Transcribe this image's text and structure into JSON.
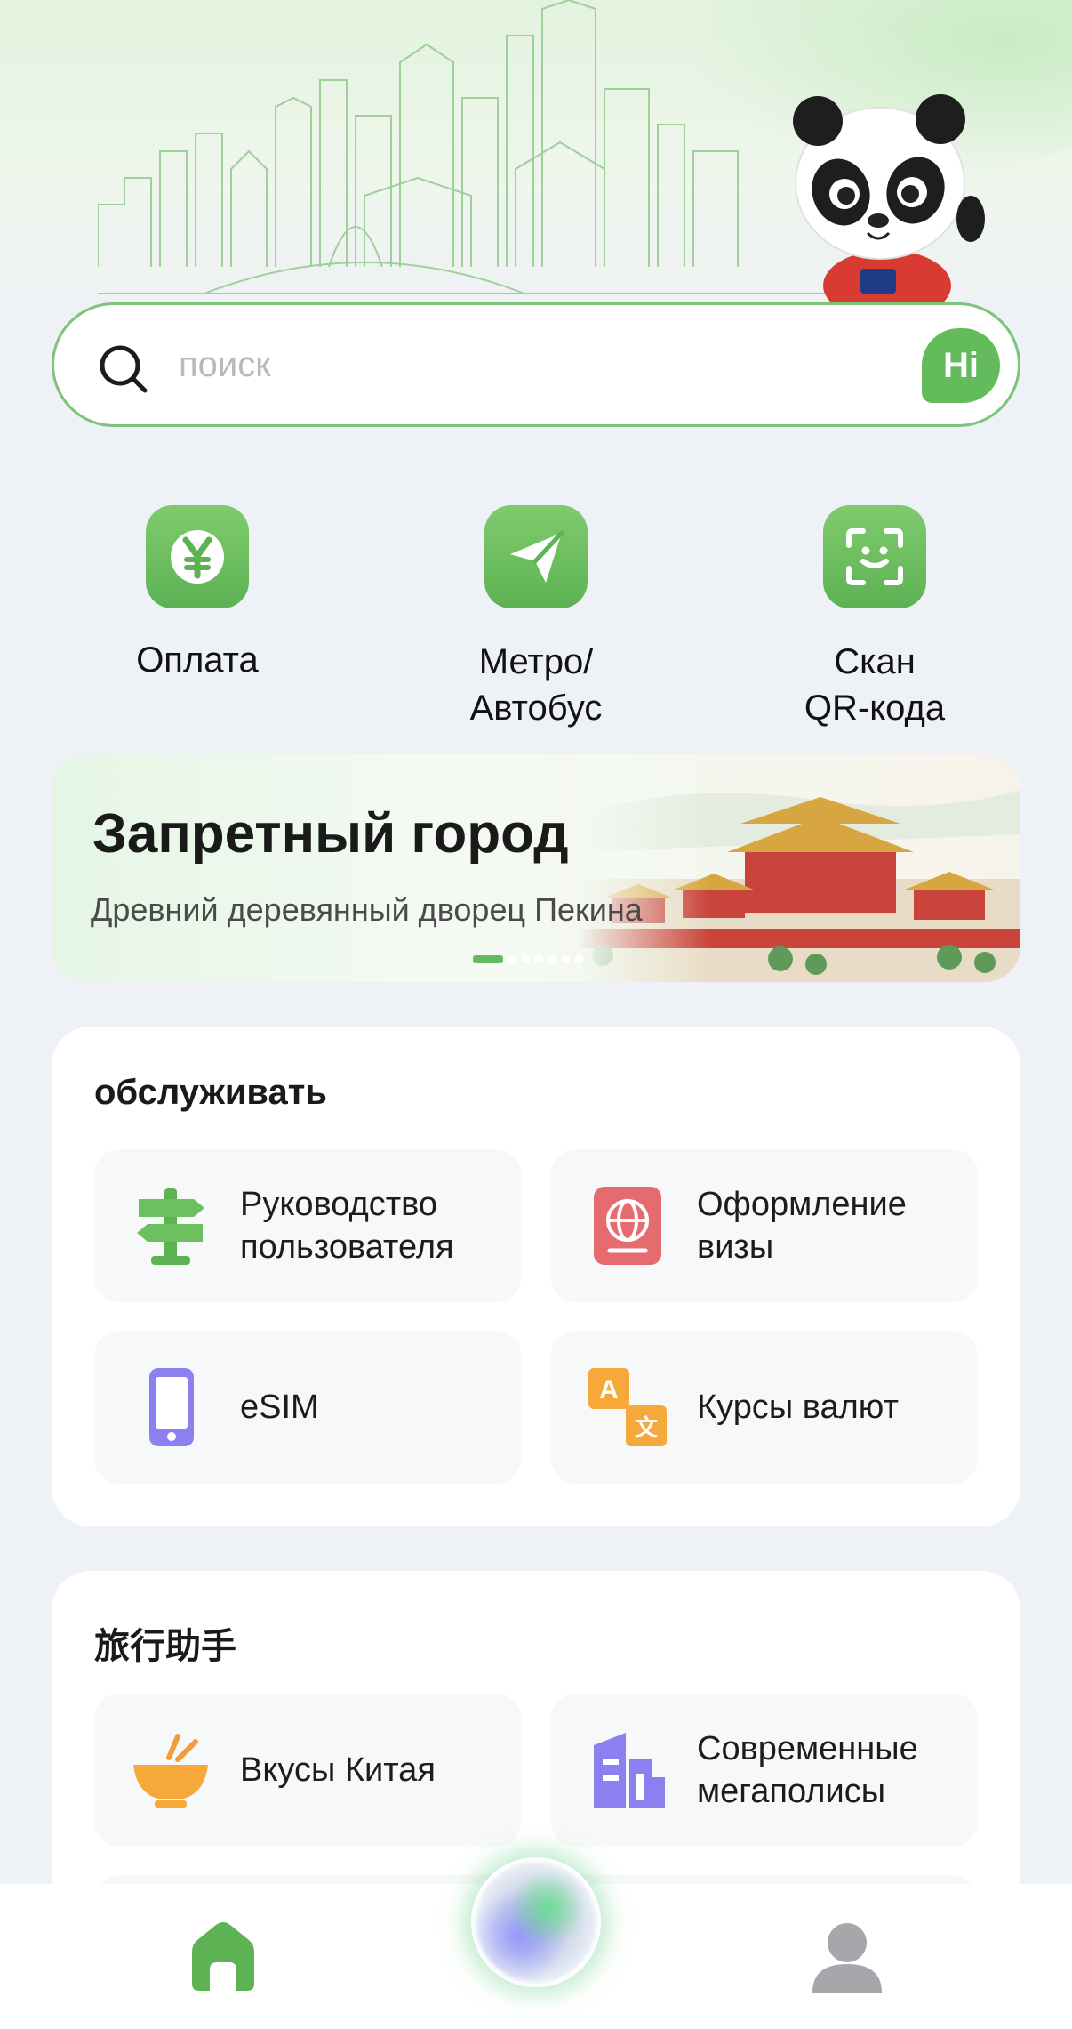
{
  "search": {
    "placeholder": "поиск",
    "hi_label": "Hi"
  },
  "quick_actions": [
    {
      "label": "Оплата",
      "icon": "yuan-icon"
    },
    {
      "label": "Метро/\nАвтобус",
      "icon": "paper-plane-icon"
    },
    {
      "label": "Скан\nQR-кода",
      "icon": "scan-icon"
    }
  ],
  "banner": {
    "title": "Запретный город",
    "subtitle": "Древний деревянный дворец Пекина",
    "pages": 7,
    "active_page": 1
  },
  "services": {
    "title": "обслуживать",
    "items": [
      {
        "label": "Руководство\nпользователя",
        "icon": "signpost-icon"
      },
      {
        "label": "Оформление\nвизы",
        "icon": "passport-icon"
      },
      {
        "label": "eSIM",
        "icon": "phone-icon"
      },
      {
        "label": "Курсы валют",
        "icon": "translate-icon"
      }
    ]
  },
  "travel": {
    "title": "旅行助手",
    "items": [
      {
        "label": "Вкусы Китая",
        "icon": "food-bowl-icon"
      },
      {
        "label": "Современные\nмегаполисы",
        "icon": "city-buildings-icon"
      }
    ]
  },
  "tabbar": {
    "home": "home-icon",
    "assistant": "ai-assistant-orb",
    "profile": "profile-icon"
  },
  "colors": {
    "accent": "#64bb5b",
    "page_background": "#eef1f5",
    "card_background": "#ffffff",
    "tile_background": "#f7f8fa"
  }
}
